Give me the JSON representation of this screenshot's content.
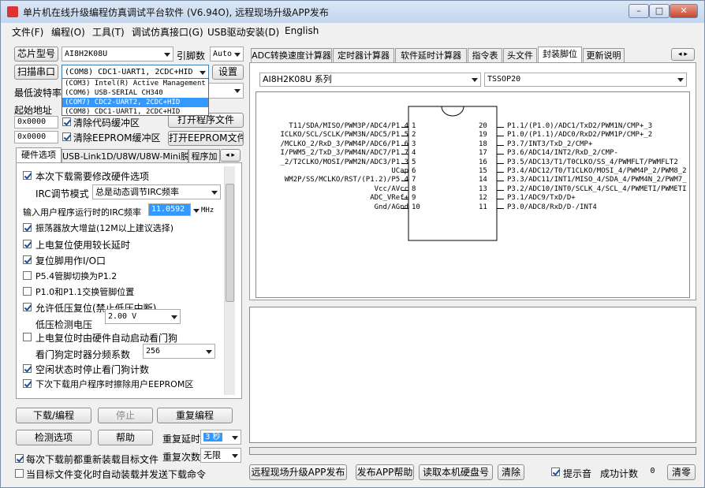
{
  "window": {
    "title": "单片机在线升级编程仿真调试平台软件 (V6.94O), 远程现场升级APP发布",
    "minimize": "–",
    "maximize": "□",
    "close": "✕"
  },
  "menu": [
    "文件(F)",
    "编程(O)",
    "工具(T)",
    "调试仿真接口(G)",
    "USB驱动安装(D)",
    "English"
  ],
  "left": {
    "chip_btn": "芯片型号",
    "chip_value": "AI8H2K08U",
    "pins_label": "引脚数",
    "pins_value": "Auto",
    "scan_btn": "扫描串口",
    "port_value": "(COM8) CDC1-UART1, 2CDC+HID",
    "settings_btn": "设置",
    "baud_label": "最低波特率",
    "baud_partial": "0",
    "port_options": [
      "(COM3) Intel(R) Active Management",
      "(COM6) USB-SERIAL CH340",
      "(COM7) CDC2-UART2, 2CDC+HID",
      "(COM8) CDC1-UART1, 2CDC+HID"
    ],
    "start_addr_label": "起始地址",
    "addr1": "0x0000",
    "clear_code_label": "清除代码缓冲区",
    "open_prog_btn": "打开程序文件",
    "addr2": "0x0000",
    "clear_eeprom_label": "清除EEPROM缓冲区",
    "open_eeprom_btn": "打开EEPROM文件",
    "tabs": [
      "硬件选项",
      "USB-Link1D/U8W/U8W-Mini脱机",
      "程序加"
    ],
    "options": {
      "modify_hw": "本次下载需要修改硬件选项",
      "irc_mode_label": "IRC调节模式",
      "irc_mode_value": "总是动态调节IRC频率",
      "irc_freq_label": "输入用户程序运行时的IRC频率",
      "irc_freq_value": "11.0592",
      "irc_unit": "MHz",
      "osc_gain": "振荡器放大增益(12M以上建议选择)",
      "power_delay": "上电复位使用较长延时",
      "reset_io": "复位脚用作I/O口",
      "p54_switch": "P5.4管脚切换为P1.2",
      "p10_swap": "P1.0和P1.1交换管脚位置",
      "lvd_reset": "允许低压复位(禁止低压中断)",
      "lvd_label": "低压检测电压",
      "lvd_value": "2.00 V",
      "wdt_power": "上电复位时由硬件自动启动看门狗",
      "wdt_div_label": "看门狗定时器分频系数",
      "wdt_div_value": "256",
      "idle_wdt": "空闲状态时停止看门狗计数",
      "erase_eeprom": "下次下载用户程序时擦除用户EEPROM区"
    },
    "download_btn": "下载/编程",
    "stop_btn": "停止",
    "reprogram_btn": "重复编程",
    "detect_btn": "检测选项",
    "help_btn": "帮助",
    "repeat_delay_label": "重复延时",
    "repeat_delay_value": "3 秒",
    "repeat_count_label": "重复次数",
    "repeat_count_value": "无限",
    "reload_each": "每次下载前都重新装载目标文件",
    "auto_reload": "当目标文件变化时自动装载并发送下载命令"
  },
  "right": {
    "tabs": [
      "ADC转换速度计算器",
      "定时器计算器",
      "软件延时计算器",
      "指令表",
      "头文件",
      "封装脚位",
      "更新说明"
    ],
    "series_value": "AI8H2K08U 系列",
    "package_value": "TSSOP20",
    "pins_left": [
      "T11/SDA/MISO/PWM3P/ADC4/P1.4",
      "ICLKO/SCL/SCLK/PWM3N/ADC5/P1.5",
      "/MCLKO_2/RxD_3/PWM4P/ADC6/P1.6",
      "I/PWM5_2/TxD_3/PWM4N/ADC7/P1.7",
      "_2/T2CLKO/MOSI/PWM2N/ADC3/P1.3",
      "UCap",
      "WM2P/SS/MCLKO/RST/(P1.2)/P5.4",
      "Vcc/AVcc",
      "ADC_VRef+",
      "Gnd/AGnd"
    ],
    "pins_left_num": [
      "1",
      "2",
      "3",
      "4",
      "5",
      "6",
      "7",
      "8",
      "9",
      "10"
    ],
    "pins_right_num": [
      "20",
      "19",
      "18",
      "17",
      "16",
      "15",
      "14",
      "13",
      "12",
      "11"
    ],
    "pins_right": [
      "P1.1/(P1.0)/ADC1/TxD2/PWM1N/CMP+_3",
      "P1.0/(P1.1)/ADC0/RxD2/PWM1P/CMP+_2",
      "P3.7/INT3/TxD_2/CMP+",
      "P3.6/ADC14/INT2/RxD_2/CMP-",
      "P3.5/ADC13/T1/T0CLKO/SS_4/PWMFLT/PWMFLT2",
      "P3.4/ADC12/T0/T1CLKO/MOSI_4/PWM4P_2/PWM8_2",
      "P3.3/ADC11/INT1/MISO_4/SDA_4/PWM4N_2/PWM7_",
      "P3.2/ADC10/INT0/SCLK_4/SCL_4/PWMETI/PWMETI",
      "P3.1/ADC9/TxD/D+",
      "P3.0/ADC8/RxD/D-/INT4"
    ]
  },
  "bottom": {
    "remote_btn": "远程现场升级APP发布",
    "publish_help_btn": "发布APP帮助",
    "read_disk_btn": "读取本机硬盘号",
    "clear_btn": "清除",
    "sound_label": "提示音",
    "success_label": "成功计数",
    "success_value": "0",
    "clear_count_btn": "清零"
  }
}
